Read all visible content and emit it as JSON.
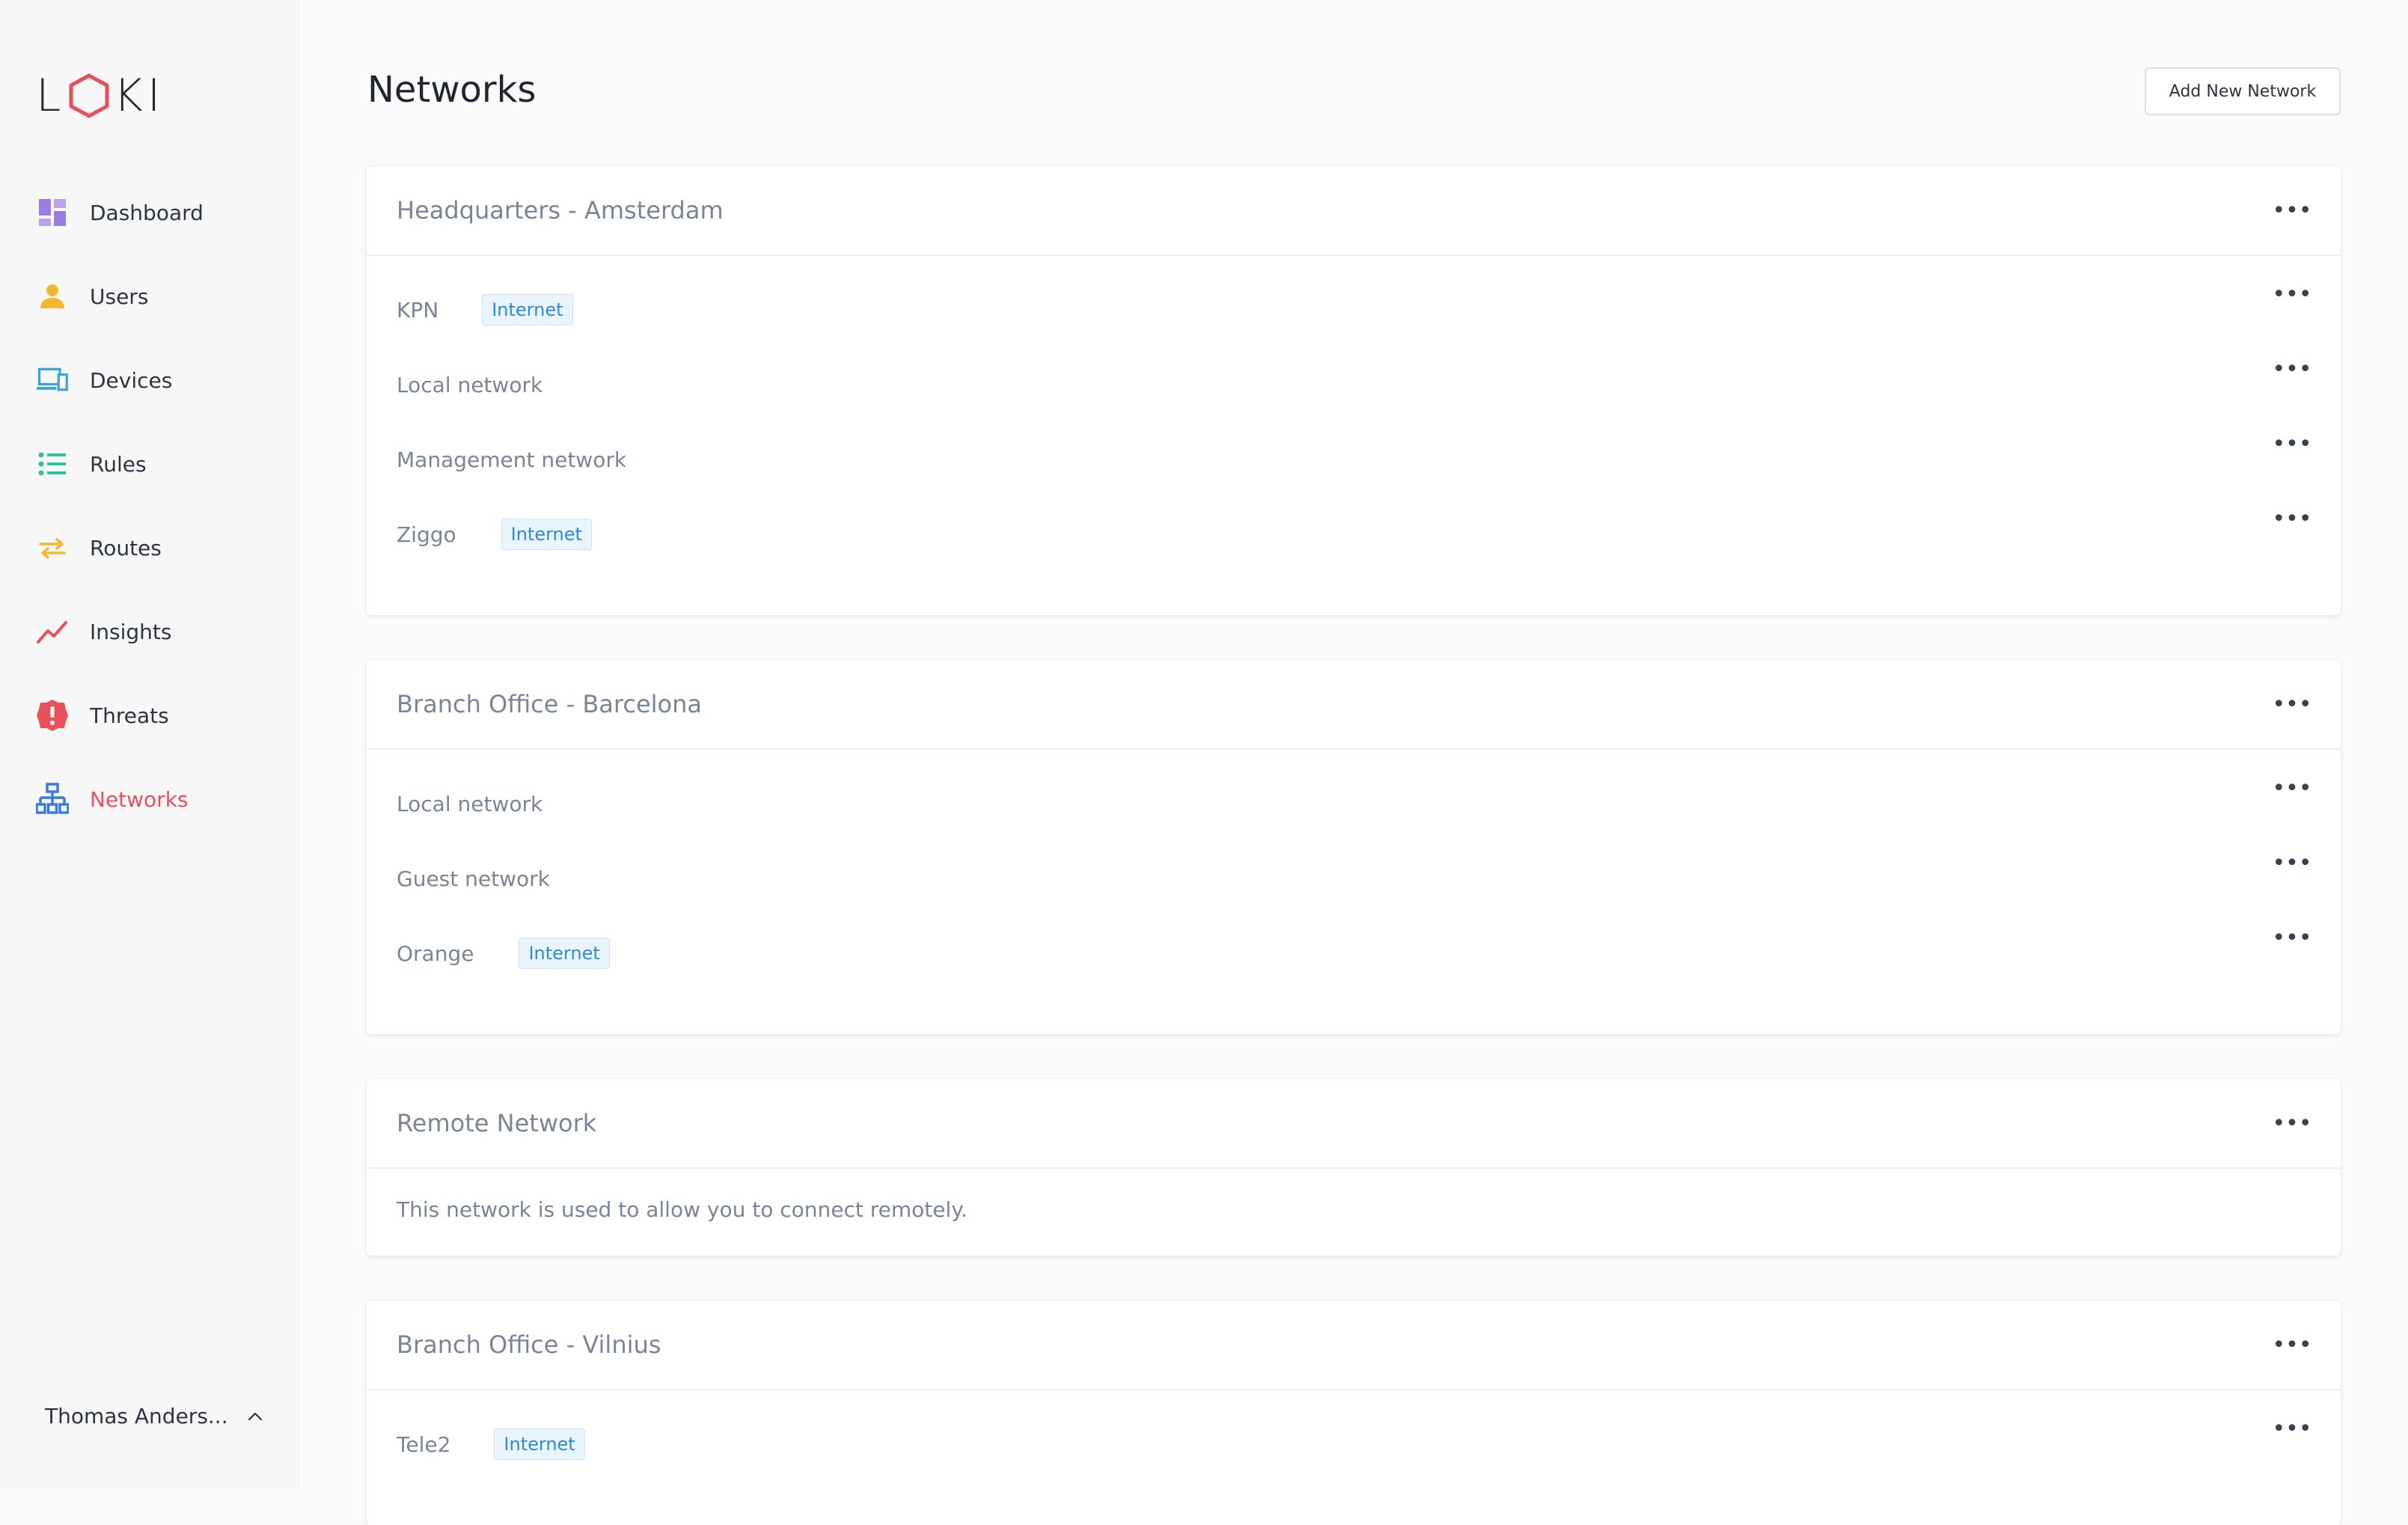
{
  "app": {
    "logo_text": "LOKI"
  },
  "sidebar": {
    "items": [
      {
        "label": "Dashboard",
        "icon": "dashboard-icon"
      },
      {
        "label": "Users",
        "icon": "user-icon"
      },
      {
        "label": "Devices",
        "icon": "devices-icon"
      },
      {
        "label": "Rules",
        "icon": "list-icon"
      },
      {
        "label": "Routes",
        "icon": "swap-arrows-icon"
      },
      {
        "label": "Insights",
        "icon": "trend-line-icon"
      },
      {
        "label": "Threats",
        "icon": "alert-octagon-icon"
      },
      {
        "label": "Networks",
        "icon": "network-topology-icon"
      }
    ],
    "active": "Networks",
    "user_name": "Thomas Anders..."
  },
  "header": {
    "title": "Networks",
    "add_button": "Add New Network"
  },
  "networks": [
    {
      "name": "Headquarters - Amsterdam",
      "items": [
        {
          "label": "KPN",
          "badge": "Internet"
        },
        {
          "label": "Local network"
        },
        {
          "label": "Management network"
        },
        {
          "label": "Ziggo",
          "badge": "Internet"
        }
      ]
    },
    {
      "name": "Branch Office - Barcelona",
      "items": [
        {
          "label": "Local network"
        },
        {
          "label": "Guest network"
        },
        {
          "label": "Orange",
          "badge": "Internet"
        }
      ]
    },
    {
      "name": "Remote Network",
      "description": "This network is used to allow you to connect remotely."
    },
    {
      "name": "Branch Office - Vilnius",
      "items": [
        {
          "label": "Tele2",
          "badge": "Internet"
        }
      ]
    }
  ],
  "colors": {
    "accent_active": "#e8505b",
    "badge_text": "#2f8ad8",
    "badge_bg": "#eaf4fd",
    "dashboard_icon": "#9b7de0",
    "users_icon": "#f5b731",
    "devices_icon": "#3aa2dc",
    "rules_icon": "#2fc3a0",
    "routes_icon": "#f5b731",
    "insights_icon": "#e8505b",
    "threats_icon": "#e8505b",
    "networks_icon": "#3a7be0"
  }
}
